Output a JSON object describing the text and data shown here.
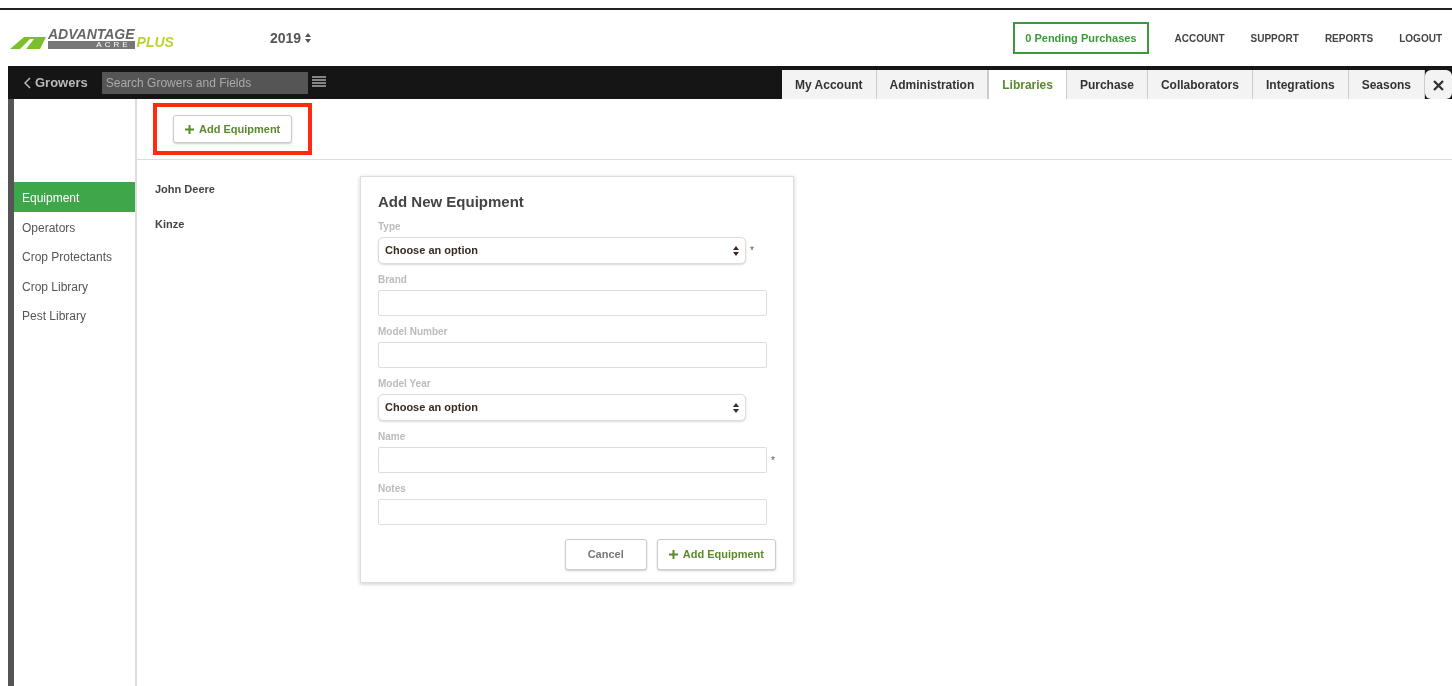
{
  "header": {
    "logo": {
      "word": "ADVANTAGE",
      "sub": "ACRE",
      "plus": "PLUS"
    },
    "season": "2019",
    "pending": "0 Pending Purchases",
    "links": [
      "ACCOUNT",
      "SUPPORT",
      "REPORTS",
      "LOGOUT"
    ]
  },
  "darkbar": {
    "back": "Growers",
    "search": {
      "placeholder": "Search Growers and Fields"
    }
  },
  "tabs": [
    {
      "label": "My Account",
      "selected": false
    },
    {
      "label": "Administration",
      "selected": false
    },
    {
      "label": "Libraries",
      "selected": true
    },
    {
      "label": "Purchase",
      "selected": false
    },
    {
      "label": "Collaborators",
      "selected": false
    },
    {
      "label": "Integrations",
      "selected": false
    },
    {
      "label": "Seasons",
      "selected": false
    }
  ],
  "toolbar": {
    "button": "Add Equipment",
    "highlighted": true
  },
  "sidebar": {
    "items": [
      {
        "label": "Equipment",
        "selected": true
      },
      {
        "label": "Operators",
        "selected": false
      },
      {
        "label": "Crop Protectants",
        "selected": false
      },
      {
        "label": "Crop Library",
        "selected": false
      },
      {
        "label": "Pest Library",
        "selected": false
      }
    ]
  },
  "brands": [
    "John Deere",
    "Kinze"
  ],
  "form": {
    "title": "Add New Equipment",
    "fields": [
      {
        "label": "Type",
        "kind": "select",
        "value": "Choose an option",
        "required": "*"
      },
      {
        "label": "Brand",
        "kind": "input"
      },
      {
        "label": "Model Number",
        "kind": "input"
      },
      {
        "label": "Model Year",
        "kind": "select",
        "value": "Choose an option"
      },
      {
        "label": "Name",
        "kind": "input",
        "required": "*"
      },
      {
        "label": "Notes",
        "kind": "input"
      }
    ],
    "cancel": "Cancel",
    "submit": "Add Equipment"
  }
}
